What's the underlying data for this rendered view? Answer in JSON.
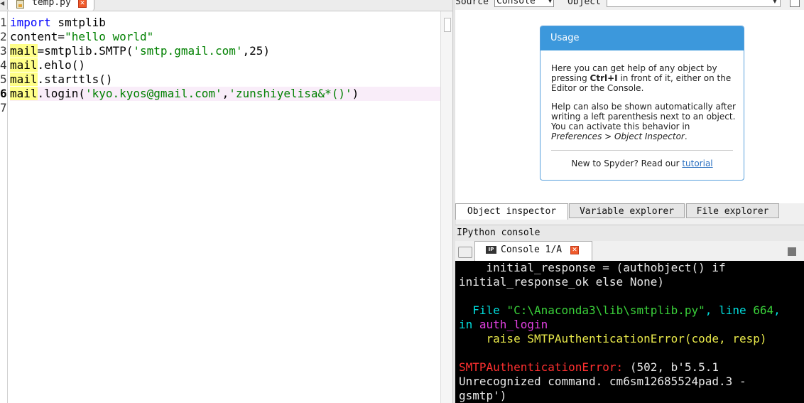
{
  "editor": {
    "tab": {
      "filename": "temp.py",
      "close_icon": "close-x-icon",
      "file_icon": "python-file-icon"
    },
    "line_numbers": [
      "1",
      "2",
      "3",
      "4",
      "5",
      "6",
      "7"
    ],
    "current_line": 6,
    "lines": [
      {
        "tokens": [
          {
            "t": "import",
            "c": "kw"
          },
          {
            "t": " smtplib",
            "c": ""
          }
        ]
      },
      {
        "tokens": [
          {
            "t": "content=",
            "c": ""
          },
          {
            "t": "\"hello world\"",
            "c": "str"
          }
        ]
      },
      {
        "tokens": [
          {
            "t": "mail",
            "c": "hl"
          },
          {
            "t": "=smtplib.SMTP(",
            "c": ""
          },
          {
            "t": "'smtp.gmail.com'",
            "c": "str"
          },
          {
            "t": ",25)",
            "c": ""
          }
        ]
      },
      {
        "tokens": [
          {
            "t": "mail",
            "c": "hl"
          },
          {
            "t": ".ehlo()",
            "c": ""
          }
        ]
      },
      {
        "tokens": [
          {
            "t": "mail",
            "c": "hl"
          },
          {
            "t": ".starttls()",
            "c": ""
          }
        ]
      },
      {
        "tokens": [
          {
            "t": "mail",
            "c": "hl"
          },
          {
            "t": ".login(",
            "c": ""
          },
          {
            "t": "'kyo.kyos@gmail.com'",
            "c": "str"
          },
          {
            "t": ",",
            "c": ""
          },
          {
            "t": "'zunshiyelisa&*()'",
            "c": "str"
          },
          {
            "t": ")",
            "c": ""
          }
        ]
      },
      {
        "tokens": []
      }
    ]
  },
  "inspector": {
    "source_label": "Source",
    "source_value": "Console",
    "object_label": "Object",
    "object_value": "",
    "usage": {
      "title": "Usage",
      "p1_a": "Here you can get help of any object by pressing ",
      "p1_key": "Ctrl+I",
      "p1_b": " in front of it, either on the Editor or the Console.",
      "p2_a": "Help can also be shown automatically after writing a left parenthesis next to an object. You can activate this behavior in ",
      "p2_em": "Preferences > Object Inspector",
      "p2_b": ".",
      "new_text": "New to Spyder? Read our ",
      "new_link": "tutorial"
    },
    "tabs": [
      "Object inspector",
      "Variable explorer",
      "File explorer"
    ]
  },
  "console": {
    "pane_title": "IPython console",
    "tab_label": "Console 1/A",
    "tab_icon": "ipython-icon",
    "output": [
      [
        {
          "t": "    initial_response = (authobject() if",
          "c": ""
        }
      ],
      [
        {
          "t": "initial_response_ok else None)",
          "c": ""
        }
      ],
      [],
      [
        {
          "t": "  File ",
          "c": "c-cyan"
        },
        {
          "t": "\"C:\\Anaconda3\\lib\\smtplib.py\"",
          "c": "c-green"
        },
        {
          "t": ", line ",
          "c": "c-cyan"
        },
        {
          "t": "664",
          "c": "c-green"
        },
        {
          "t": ",",
          "c": "c-cyan"
        }
      ],
      [
        {
          "t": "in ",
          "c": "c-cyan"
        },
        {
          "t": "auth_login",
          "c": "c-magenta"
        }
      ],
      [
        {
          "t": "    raise SMTPAuthenticationError(code, resp)",
          "c": "c-yellow"
        }
      ],
      [],
      [
        {
          "t": "SMTPAuthenticationError:",
          "c": "c-red"
        },
        {
          "t": " (502, b'5.5.1",
          "c": ""
        }
      ],
      [
        {
          "t": "Unrecognized command. cm6sm12685524pad.3 -",
          "c": ""
        }
      ],
      [
        {
          "t": "gsmtp')",
          "c": ""
        }
      ]
    ]
  }
}
